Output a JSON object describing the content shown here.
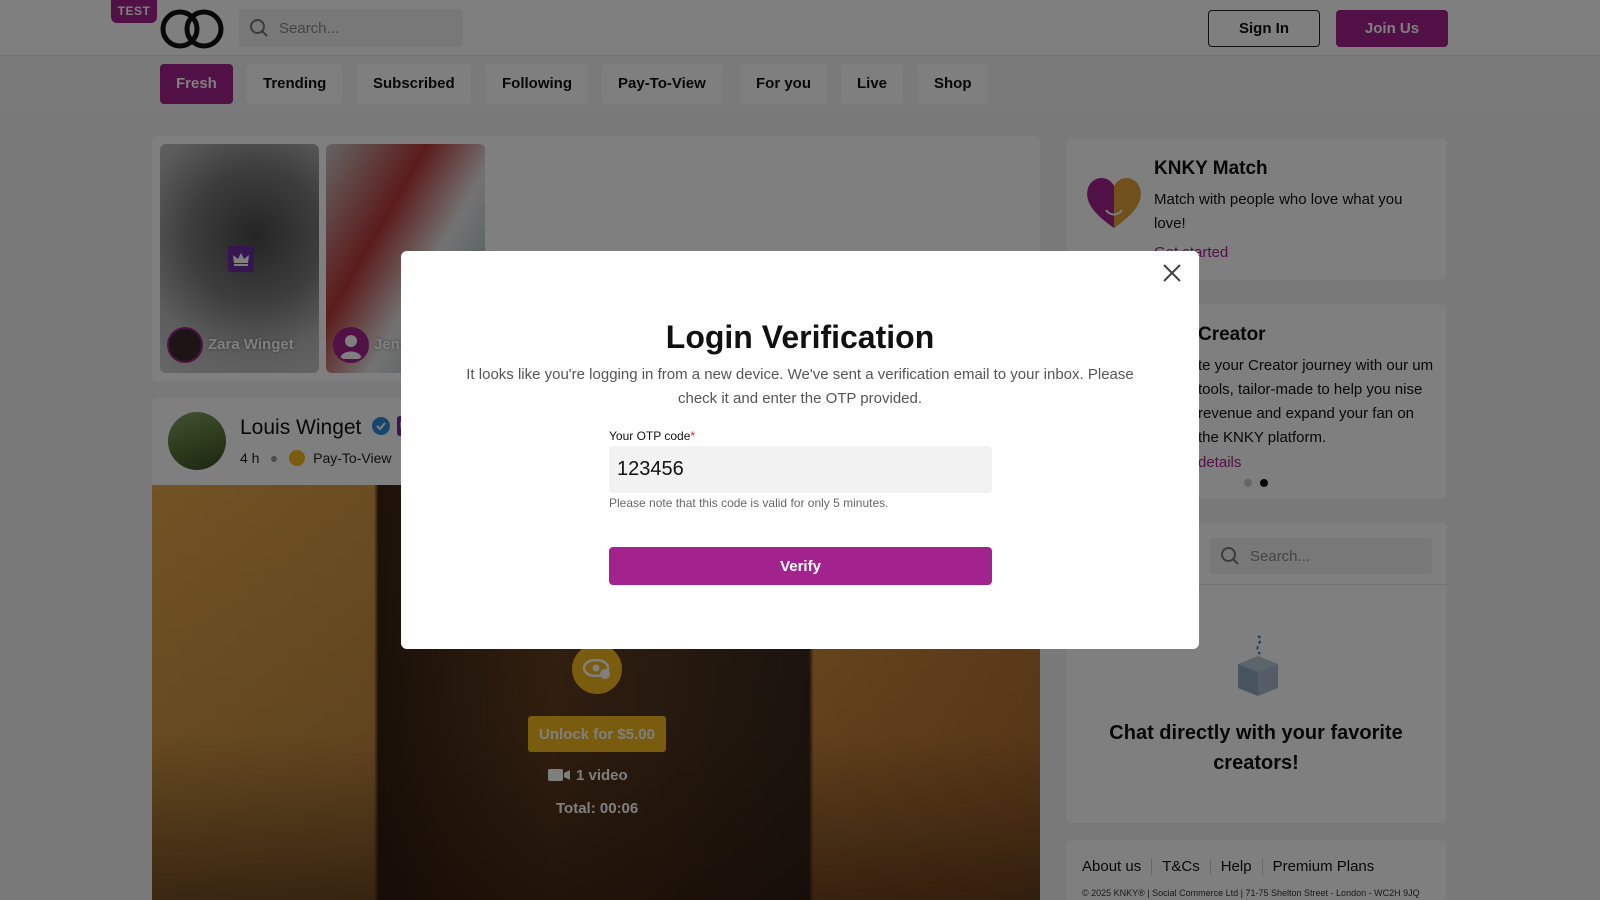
{
  "header": {
    "test_badge": "TEST",
    "search_placeholder": "Search...",
    "signin_label": "Sign In",
    "join_label": "Join Us"
  },
  "tabs": [
    "Fresh",
    "Trending",
    "Subscribed",
    "Following",
    "Pay-To-View",
    "For you",
    "Live",
    "Shop"
  ],
  "active_tab": "Fresh",
  "stories": [
    {
      "name": "Zara Winget"
    },
    {
      "name": "Jen"
    }
  ],
  "post": {
    "author": "Louis Winget",
    "time": "4 h",
    "type": "Pay-To-View",
    "unlock_label": "Unlock for $5.00",
    "video_count": "1 video",
    "total": "Total: 00:06"
  },
  "right": {
    "match": {
      "title": "KNKY Match",
      "text": "Match with people who love what you love!",
      "link": "Get started"
    },
    "creator": {
      "title": "Creator",
      "text": "te your Creator journey with our um tools, tailor-made to help you nise revenue and expand your fan on the KNKY platform.",
      "link": "details"
    },
    "chat": {
      "search_placeholder": "Search...",
      "title": "Chat directly with your favorite creators!"
    },
    "footer": {
      "links": [
        "About us",
        "T&Cs",
        "Help",
        "Premium Plans"
      ],
      "copyright": "© 2025 KNKY® | Social Commerce Ltd | 71-75 Shelton Street - London - WC2H 9JQ"
    }
  },
  "modal": {
    "title": "Login Verification",
    "description": "It looks like you're logging in from a new device. We've sent a verification email to your inbox. Please check it and enter the OTP provided.",
    "otp_label": "Your OTP code",
    "otp_required_mark": "*",
    "otp_value": "123456",
    "otp_note": "Please note that this code is valid for only 5 minutes.",
    "verify_label": "Verify"
  },
  "colors": {
    "brand": "#a3238e",
    "gold": "#f2b91b"
  }
}
